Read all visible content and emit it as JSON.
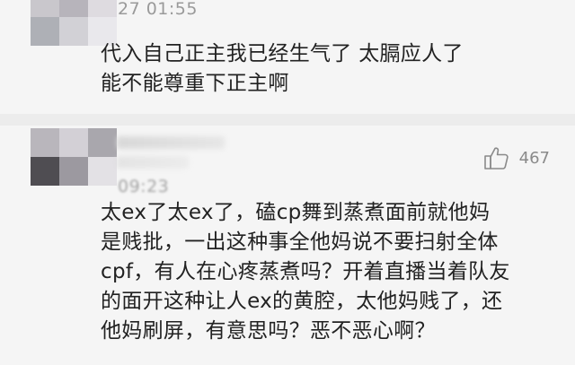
{
  "comments": [
    {
      "timestamp": "27 01:55",
      "lines": [
        "代入自己正主我已经生气了 太膈应人了",
        "能不能尊重下正主啊"
      ]
    },
    {
      "timestamp": "09:23",
      "like_icon": "thumbs-up-icon",
      "like_count": "467",
      "lines": [
        "太ex了太ex了，磕cp舞到蒸煮面前就他妈",
        "是贱批，一出这种事全他妈说不要扫射全体",
        "cpf，有人在心疼蒸煮吗？开着直播当着队友",
        "的面开这种让人ex的黄腔，太他妈贱了，还",
        "他妈刷屏，有意思吗？恶不恶心啊？"
      ]
    }
  ],
  "colors": {
    "background": "#ececec",
    "card": "#f5f5f5",
    "text": "#222222",
    "muted": "#9a9a9a"
  }
}
